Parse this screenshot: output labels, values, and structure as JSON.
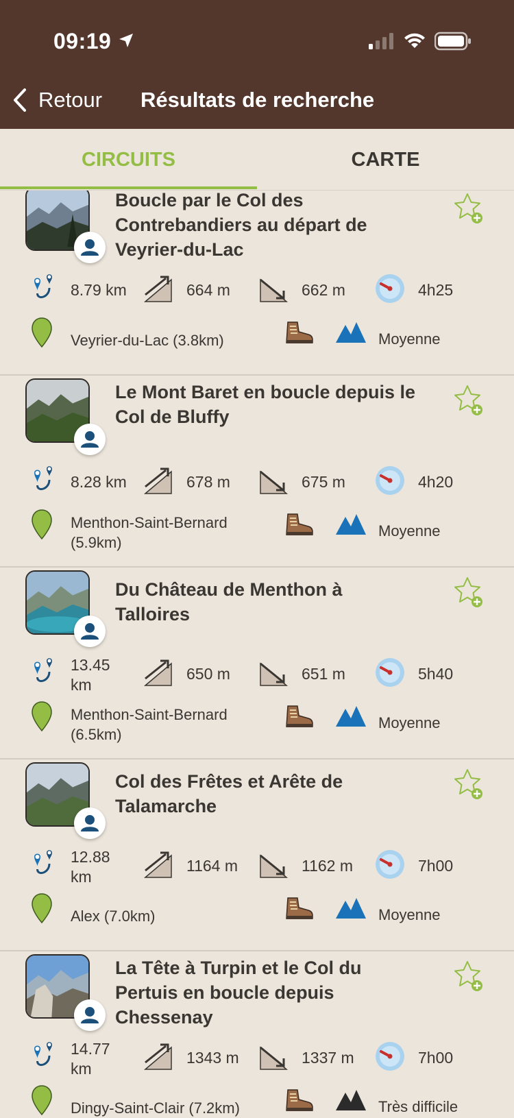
{
  "status_bar": {
    "time": "09:19"
  },
  "nav": {
    "back_label": "Retour",
    "title": "Résultats de recherche"
  },
  "tabs": [
    {
      "label": "CIRCUITS",
      "active": true
    },
    {
      "label": "CARTE",
      "active": false
    }
  ],
  "colors": {
    "header": "#53362c",
    "accent": "#93bd44",
    "background": "#ece5db",
    "icon_blue": "#1a73b8"
  },
  "circuits": [
    {
      "title": "Boucle par le Col des Contrebandiers au départ de Veyrier-du-Lac",
      "distance": "8.79 km",
      "ascent": "664 m",
      "descent": "662 m",
      "duration": "4h25",
      "location": "Veyrier-du-Lac (3.8km)",
      "difficulty": "Moyenne",
      "difficulty_color": "#1a73b8"
    },
    {
      "title": "Le Mont Baret en boucle depuis le Col de Bluffy",
      "distance": "8.28 km",
      "ascent": "678 m",
      "descent": "675 m",
      "duration": "4h20",
      "location": "Menthon-Saint-Bernard (5.9km)",
      "difficulty": "Moyenne",
      "difficulty_color": "#1a73b8"
    },
    {
      "title": "Du Château de Menthon à Talloires",
      "distance": "13.45 km",
      "ascent": "650 m",
      "descent": "651 m",
      "duration": "5h40",
      "location": "Menthon-Saint-Bernard (6.5km)",
      "difficulty": "Moyenne",
      "difficulty_color": "#1a73b8"
    },
    {
      "title": "Col des Frêtes et Arête de Talamarche",
      "distance": "12.88 km",
      "ascent": "1164 m",
      "descent": "1162 m",
      "duration": "7h00",
      "location": "Alex (7.0km)",
      "difficulty": "Moyenne",
      "difficulty_color": "#1a73b8"
    },
    {
      "title": "La Tête à Turpin et le Col du Pertuis en boucle depuis Chessenay",
      "distance": "14.77 km",
      "ascent": "1343 m",
      "descent": "1337 m",
      "duration": "7h00",
      "location": "Dingy-Saint-Clair (7.2km)",
      "difficulty": "Très difficile",
      "difficulty_color": "#2b2b2b"
    }
  ]
}
